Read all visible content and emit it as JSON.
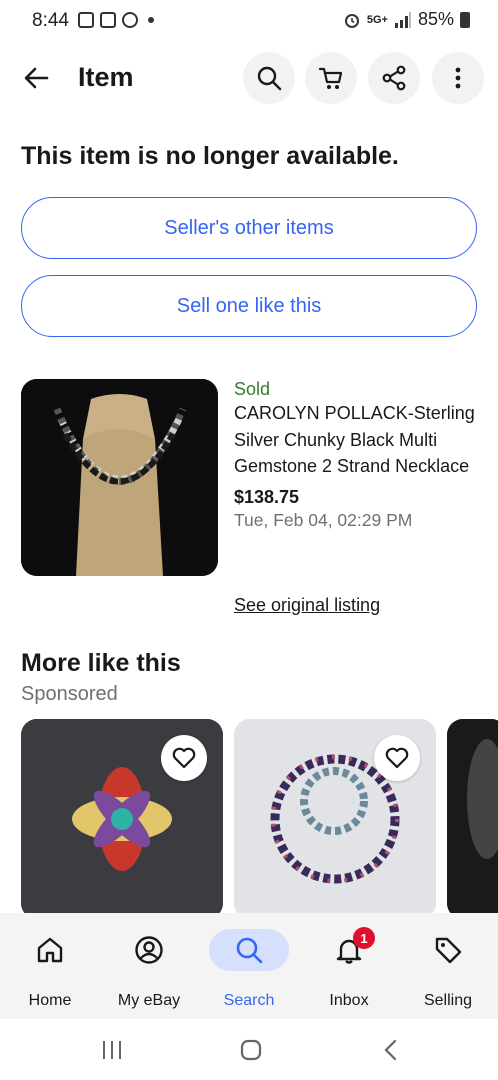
{
  "status_bar": {
    "time": "8:44",
    "network": "5G+",
    "battery": "85%"
  },
  "header": {
    "title": "Item",
    "back_icon": "arrow-left-icon",
    "search_icon": "search-icon",
    "cart_icon": "cart-icon",
    "share_icon": "share-icon",
    "more_icon": "more-vertical-icon"
  },
  "message": "This item is no longer available.",
  "buttons": {
    "sellers_other_items": "Seller's other items",
    "sell_one_like_this": "Sell one like this"
  },
  "item": {
    "status": "Sold",
    "title": "CAROLYN POLLACK-Sterling Silver Chunky Black Multi Gemstone 2 Strand Necklace",
    "price": "$138.75",
    "date": "Tue, Feb 04, 02:29 PM",
    "link": "See original listing"
  },
  "more_like_this": {
    "title": "More like this",
    "subtitle": "Sponsored"
  },
  "bottom_nav": {
    "items": [
      {
        "label": "Home",
        "icon": "home-icon"
      },
      {
        "label": "My eBay",
        "icon": "profile-icon"
      },
      {
        "label": "Search",
        "icon": "search-icon"
      },
      {
        "label": "Inbox",
        "icon": "bell-icon",
        "badge": "1"
      },
      {
        "label": "Selling",
        "icon": "tag-icon"
      }
    ],
    "active": "Search"
  },
  "colors": {
    "accent": "#3665f3",
    "sold": "#2f7d32",
    "badge": "#e0102a"
  }
}
